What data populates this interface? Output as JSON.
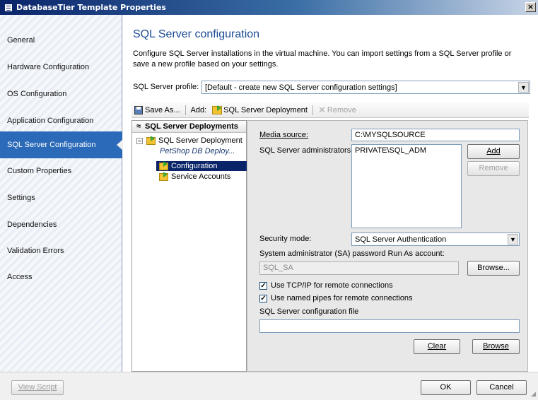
{
  "window": {
    "title": "DatabaseTier Template Properties",
    "close_glyph": "×"
  },
  "nav": {
    "items": [
      {
        "label": "General"
      },
      {
        "label": "Hardware Configuration"
      },
      {
        "label": "OS Configuration"
      },
      {
        "label": "Application Configuration"
      },
      {
        "label": "SQL Server Configuration"
      },
      {
        "label": "Custom Properties"
      },
      {
        "label": "Settings"
      },
      {
        "label": "Dependencies"
      },
      {
        "label": "Validation Errors"
      },
      {
        "label": "Access"
      }
    ],
    "active": "SQL Server Configuration"
  },
  "page": {
    "title": "SQL Server configuration",
    "description": "Configure SQL Server installations in the virtual machine. You can import settings from a SQL Server profile or save a new profile based on your settings.",
    "profile_label": "SQL Server profile:",
    "profile_value": "[Default - create new SQL Server configuration settings]"
  },
  "toolbar": {
    "save_as": "Save As...",
    "add_label": "Add:",
    "add_deployment": "SQL Server Deployment",
    "remove": "Remove"
  },
  "tree": {
    "header": "SQL Server Deployments",
    "root_label": "SQL Server Deployment",
    "root_subtitle": "PetShop DB Deploy...",
    "children": [
      "Configuration",
      "Service Accounts"
    ],
    "selected": "Configuration"
  },
  "details": {
    "media_source_label": "Media source:",
    "media_source_value": "C:\\MYSQLSOURCE",
    "admins_label": "SQL Server administrators:",
    "admins_value": "PRIVATE\\SQL_ADM",
    "add_button": "Add",
    "remove_button": "Remove",
    "security_mode_label": "Security mode:",
    "security_mode_value": "SQL Server Authentication",
    "sa_label": "System administrator (SA) password Run As account:",
    "sa_value": "SQL_SA",
    "browse_button": "Browse...",
    "tcpip_label": "Use TCP/IP for remote connections",
    "tcpip_checked": true,
    "pipes_label": "Use named pipes for remote connections",
    "pipes_checked": true,
    "config_file_label": "SQL Server configuration file",
    "config_file_value": "",
    "clear_button": "Clear",
    "browse2_button": "Browse"
  },
  "footer": {
    "view_script": "View Script",
    "ok": "OK",
    "cancel": "Cancel"
  }
}
